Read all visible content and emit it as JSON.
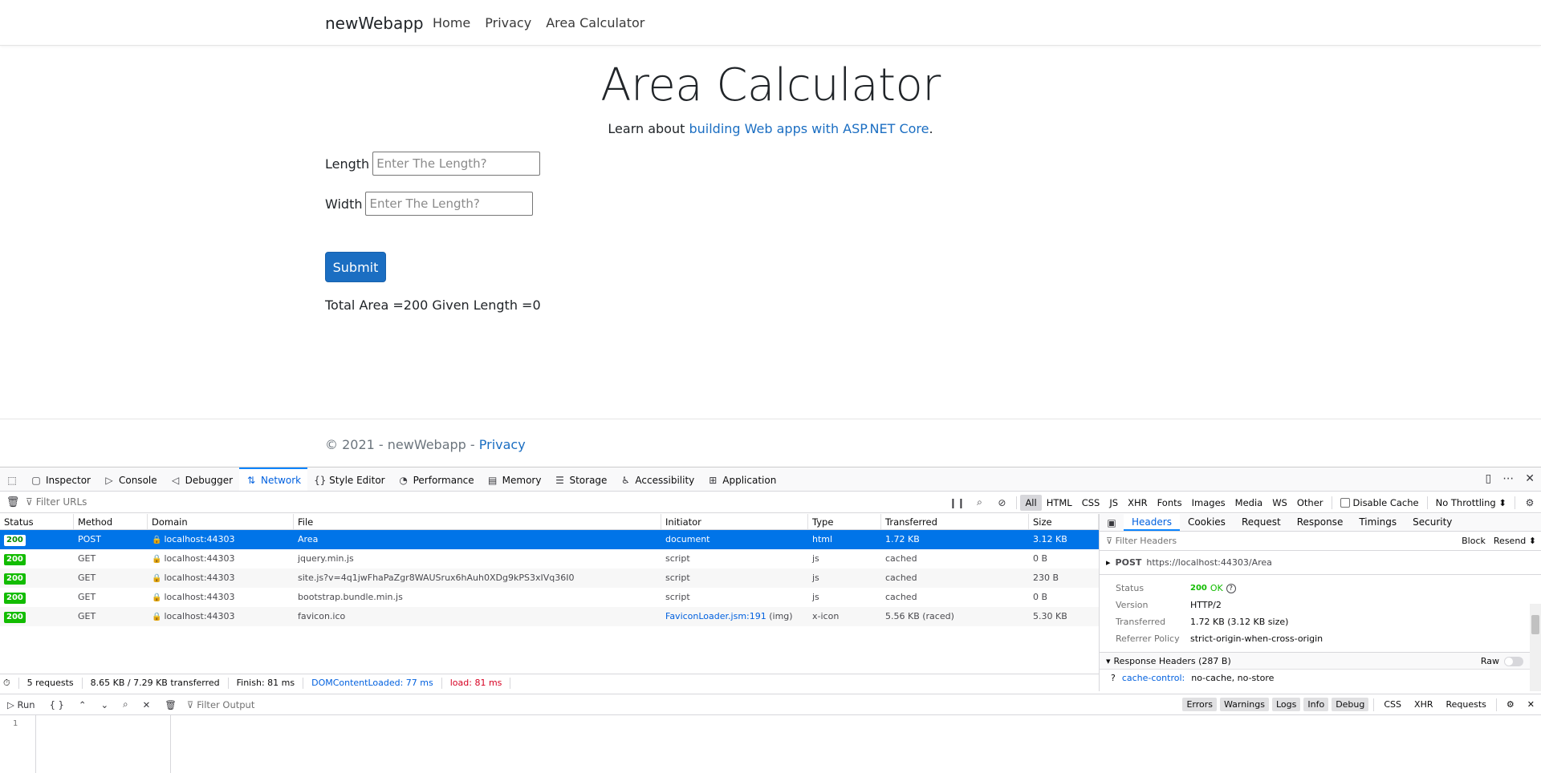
{
  "page": {
    "brand": "newWebapp",
    "nav": [
      "Home",
      "Privacy",
      "Area Calculator"
    ],
    "title": "Area Calculator",
    "subtitle_prefix": "Learn about ",
    "subtitle_link": "building Web apps with ASP.NET Core",
    "subtitle_suffix": ".",
    "length_label": "Length",
    "length_placeholder": "Enter The Length?",
    "width_label": "Width",
    "width_placeholder": "Enter The Length?",
    "submit_label": "Submit",
    "result": "Total Area =200 Given Length =0",
    "footer_prefix": "© 2021 - newWebapp - ",
    "footer_link": "Privacy"
  },
  "devtools": {
    "tabs": [
      {
        "label": "Inspector",
        "icon": "▢"
      },
      {
        "label": "Console",
        "icon": "▷"
      },
      {
        "label": "Debugger",
        "icon": "◁"
      },
      {
        "label": "Network",
        "icon": "⇅"
      },
      {
        "label": "Style Editor",
        "icon": "{}"
      },
      {
        "label": "Performance",
        "icon": "◔"
      },
      {
        "label": "Memory",
        "icon": "▤"
      },
      {
        "label": "Storage",
        "icon": "☰"
      },
      {
        "label": "Accessibility",
        "icon": "♿"
      },
      {
        "label": "Application",
        "icon": "⊞"
      }
    ],
    "active_tab": "Network",
    "filter_placeholder": "Filter URLs",
    "type_filters": [
      "All",
      "HTML",
      "CSS",
      "JS",
      "XHR",
      "Fonts",
      "Images",
      "Media",
      "WS",
      "Other"
    ],
    "disable_cache": "Disable Cache",
    "throttling": "No Throttling ⬍",
    "columns": [
      "Status",
      "Method",
      "Domain",
      "File",
      "Initiator",
      "Type",
      "Transferred",
      "Size"
    ],
    "rows": [
      {
        "status": "200",
        "method": "POST",
        "domain": "localhost:44303",
        "file": "Area",
        "initiator": "document",
        "initiator_extra": "",
        "type": "html",
        "transferred": "1.72 KB",
        "size": "3.12 KB"
      },
      {
        "status": "200",
        "method": "GET",
        "domain": "localhost:44303",
        "file": "jquery.min.js",
        "initiator": "script",
        "initiator_extra": "",
        "type": "js",
        "transferred": "cached",
        "size": "0 B"
      },
      {
        "status": "200",
        "method": "GET",
        "domain": "localhost:44303",
        "file": "site.js?v=4q1jwFhaPaZgr8WAUSrux6hAuh0XDg9kPS3xIVq36I0",
        "initiator": "script",
        "initiator_extra": "",
        "type": "js",
        "transferred": "cached",
        "size": "230 B"
      },
      {
        "status": "200",
        "method": "GET",
        "domain": "localhost:44303",
        "file": "bootstrap.bundle.min.js",
        "initiator": "script",
        "initiator_extra": "",
        "type": "js",
        "transferred": "cached",
        "size": "0 B"
      },
      {
        "status": "200",
        "method": "GET",
        "domain": "localhost:44303",
        "file": "favicon.ico",
        "initiator": "FaviconLoader.jsm:191",
        "initiator_extra": " (img)",
        "type": "x-icon",
        "transferred": "5.56 KB (raced)",
        "size": "5.30 KB"
      }
    ],
    "summary": {
      "requests": "5 requests",
      "transferred": "8.65 KB / 7.29 KB transferred",
      "finish": "Finish: 81 ms",
      "dcl": "DOMContentLoaded: 77 ms",
      "load": "load: 81 ms"
    },
    "side": {
      "tabs": [
        "Headers",
        "Cookies",
        "Request",
        "Response",
        "Timings",
        "Security"
      ],
      "filter_placeholder": "Filter Headers",
      "block": "Block",
      "resend": "Resend ⬍",
      "req_method": "POST",
      "req_url": "https://localhost:44303/Area",
      "fields": [
        {
          "k": "Status",
          "v": "OK",
          "badge": "200"
        },
        {
          "k": "Version",
          "v": "HTTP/2"
        },
        {
          "k": "Transferred",
          "v": "1.72 KB (3.12 KB size)"
        },
        {
          "k": "Referrer Policy",
          "v": "strict-origin-when-cross-origin"
        }
      ],
      "resp_headers": "Response Headers (287 B)",
      "raw": "Raw",
      "header_name": "cache-control:",
      "header_value": "no-cache, no-store"
    },
    "console": {
      "run": "Run",
      "braces": "{ }",
      "filter_placeholder": "Filter Output",
      "levels": [
        "Errors",
        "Warnings",
        "Logs",
        "Info",
        "Debug"
      ],
      "extras": [
        "CSS",
        "XHR",
        "Requests"
      ],
      "line_number": "1"
    }
  }
}
